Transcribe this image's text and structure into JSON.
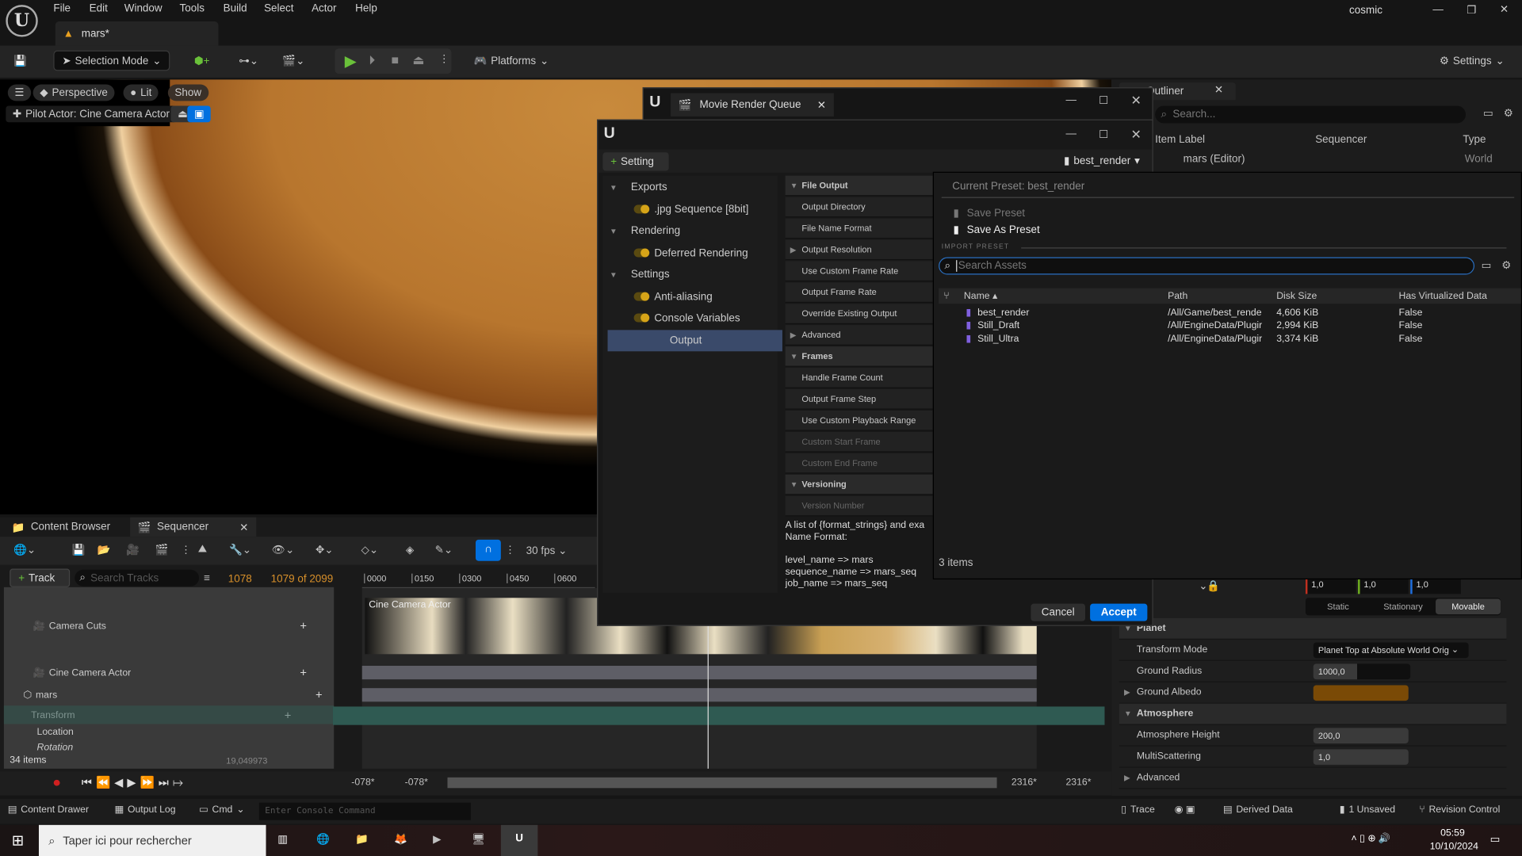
{
  "app": {
    "menu": [
      "File",
      "Edit",
      "Window",
      "Tools",
      "Build",
      "Select",
      "Actor",
      "Help"
    ],
    "doc_tab": "mars*",
    "user": "cosmic"
  },
  "toolbar": {
    "selection_mode": "Selection Mode",
    "platforms": "Platforms",
    "settings": "Settings"
  },
  "viewport": {
    "perspective": "Perspective",
    "lit": "Lit",
    "show": "Show",
    "pilot": "Pilot Actor: Cine Camera Actor"
  },
  "outliner": {
    "tab": "Outliner",
    "search_placeholder": "Search...",
    "col_item": "Item Label",
    "col_seq": "Sequencer",
    "col_type": "Type",
    "row_label": "mars (Editor)",
    "row_type": "World"
  },
  "details": {
    "color_values": [
      "1,0",
      "1,0",
      "1,0"
    ],
    "mobility_options": [
      "Static",
      "Stationary",
      "Movable"
    ],
    "mobility_selected": "Movable",
    "sections": {
      "planet": "Planet",
      "atmosphere": "Atmosphere",
      "advanced": "Advanced"
    },
    "props": {
      "transform_mode": {
        "label": "Transform Mode",
        "value": "Planet Top at Absolute World Orig"
      },
      "ground_radius": {
        "label": "Ground Radius",
        "value": "1000,0"
      },
      "ground_albedo": {
        "label": "Ground Albedo",
        "color": "#7a4a06"
      },
      "atmosphere_height": {
        "label": "Atmosphere Height",
        "value": "200,0"
      },
      "multiscattering": {
        "label": "MultiScattering",
        "value": "1,0"
      }
    }
  },
  "bottom": {
    "tabs": [
      "Content Browser",
      "Sequencer"
    ],
    "fps": "30 fps",
    "track_button": "Track",
    "search_tracks": "Search Tracks",
    "current_frame": "1078",
    "frame_of": "1079 of 2099",
    "ruler": [
      "0000",
      "0150",
      "0300",
      "0450",
      "0600"
    ],
    "tracks": [
      "Camera Cuts",
      "Cine Camera Actor",
      "mars",
      "Transform",
      "Location",
      "Rotation"
    ],
    "clip_label": "Cine Camera Actor",
    "items_count": "34 items",
    "roll_value": "19,049973",
    "range_start": [
      "-078*",
      "-078*"
    ],
    "range_end": [
      "2316*",
      "2316*"
    ]
  },
  "statusbar": {
    "content_drawer": "Content Drawer",
    "output_log": "Output Log",
    "cmd": "Cmd",
    "console_placeholder": "Enter Console Command",
    "trace": "Trace",
    "derived_data": "Derived Data",
    "unsaved": "1 Unsaved",
    "revision_control": "Revision Control"
  },
  "taskbar": {
    "search_placeholder": "Taper ici pour rechercher",
    "time": "05:59",
    "date": "10/10/2024"
  },
  "mrq": {
    "title": "Movie Render Queue"
  },
  "dialog": {
    "setting_button": "Setting",
    "preset_dropdown": "best_render",
    "list": [
      {
        "label": "Exports",
        "type": "header"
      },
      {
        "label": ".jpg Sequence [8bit]",
        "type": "item"
      },
      {
        "label": "Rendering",
        "type": "header"
      },
      {
        "label": "Deferred Rendering",
        "type": "item"
      },
      {
        "label": "Settings",
        "type": "header"
      },
      {
        "label": "Anti-aliasing",
        "type": "item"
      },
      {
        "label": "Console Variables",
        "type": "item"
      },
      {
        "label": "Output",
        "type": "selected"
      }
    ],
    "properties": [
      {
        "label": "File Output",
        "kind": "sec"
      },
      {
        "label": "Output Directory"
      },
      {
        "label": "File Name Format"
      },
      {
        "label": "Output Resolution",
        "kind": "collapsed"
      },
      {
        "label": "Use Custom Frame Rate"
      },
      {
        "label": "Output Frame Rate"
      },
      {
        "label": "Override Existing Output"
      },
      {
        "label": "Advanced",
        "kind": "collapsed"
      },
      {
        "label": "Frames",
        "kind": "sec"
      },
      {
        "label": "Handle Frame Count"
      },
      {
        "label": "Output Frame Step"
      },
      {
        "label": "Use Custom Playback Range"
      },
      {
        "label": "Custom Start Frame",
        "kind": "dim"
      },
      {
        "label": "Custom End Frame",
        "kind": "dim"
      },
      {
        "label": "Versioning",
        "kind": "sec"
      },
      {
        "label": "Version Number",
        "kind": "dim"
      }
    ],
    "description": [
      "A list of {format_strings} and exa",
      "Name Format:",
      "",
      "level_name => mars",
      "sequence_name => mars_seq",
      "job_name => mars_seq"
    ],
    "cancel": "Cancel",
    "accept": "Accept"
  },
  "preset_popup": {
    "current": "Current Preset: best_render",
    "save_preset": "Save Preset",
    "save_as_preset": "Save As Preset",
    "import_label": "IMPORT PRESET",
    "search_placeholder": "Search Assets",
    "columns": [
      "Name",
      "Path",
      "Disk Size",
      "Has Virtualized Data"
    ],
    "rows": [
      [
        "best_render",
        "/All/Game/best_rende",
        "4,606 KiB",
        "False"
      ],
      [
        "Still_Draft",
        "/All/EngineData/Plugir",
        "2,994 KiB",
        "False"
      ],
      [
        "Still_Ultra",
        "/All/EngineData/Plugir",
        "3,374 KiB",
        "False"
      ]
    ],
    "count": "3 items"
  },
  "colors": {
    "accent": "#0070e0",
    "play": "#6ac13a",
    "frame": "#d8902a",
    "toggle": "#d6a418"
  }
}
